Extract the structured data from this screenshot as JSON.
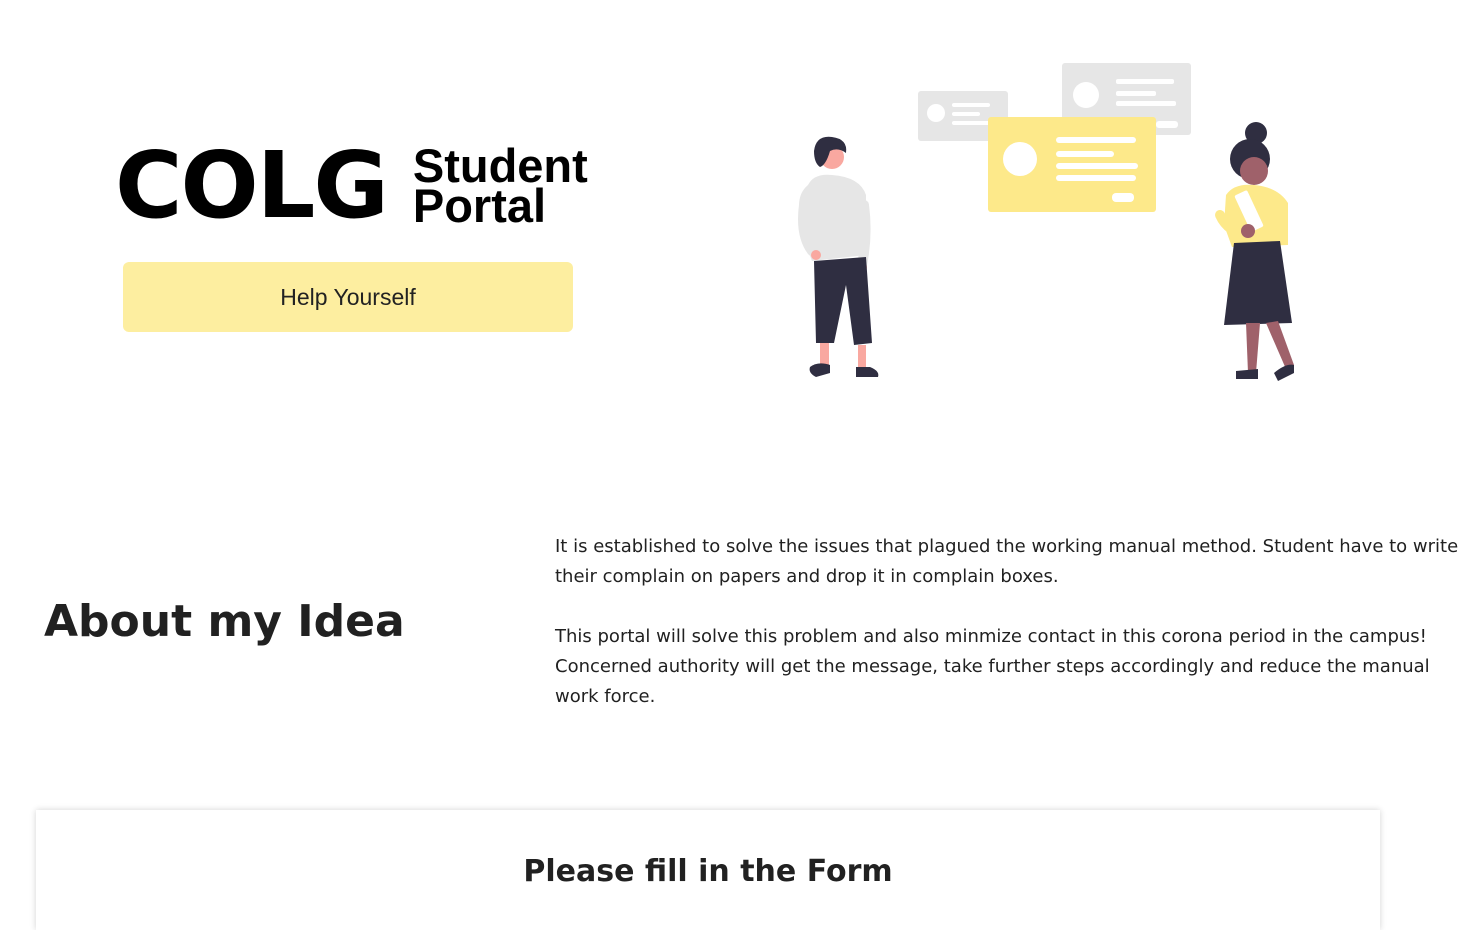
{
  "hero": {
    "brand": "COLG",
    "subtitle_line1": "Student",
    "subtitle_line2": "Portal",
    "cta_label": "Help Yourself"
  },
  "about": {
    "heading": "About my Idea",
    "paragraph1": "It is established to solve the issues that plagued the working manual method. Student have to write their complain on papers and drop it in complain boxes.",
    "paragraph2": "This portal will solve this problem and also minmize contact in this corona period in the campus! Concerned authority will get the message, take further steps accordingly and reduce the manual work force."
  },
  "form": {
    "title": "Please fill in the Form"
  },
  "colors": {
    "accent": "#fdeea0",
    "card_grey": "#e6e6e6",
    "card_yellow": "#fde98a",
    "text": "#212121"
  },
  "icons": {
    "illustration": "people-messaging-illustration"
  }
}
